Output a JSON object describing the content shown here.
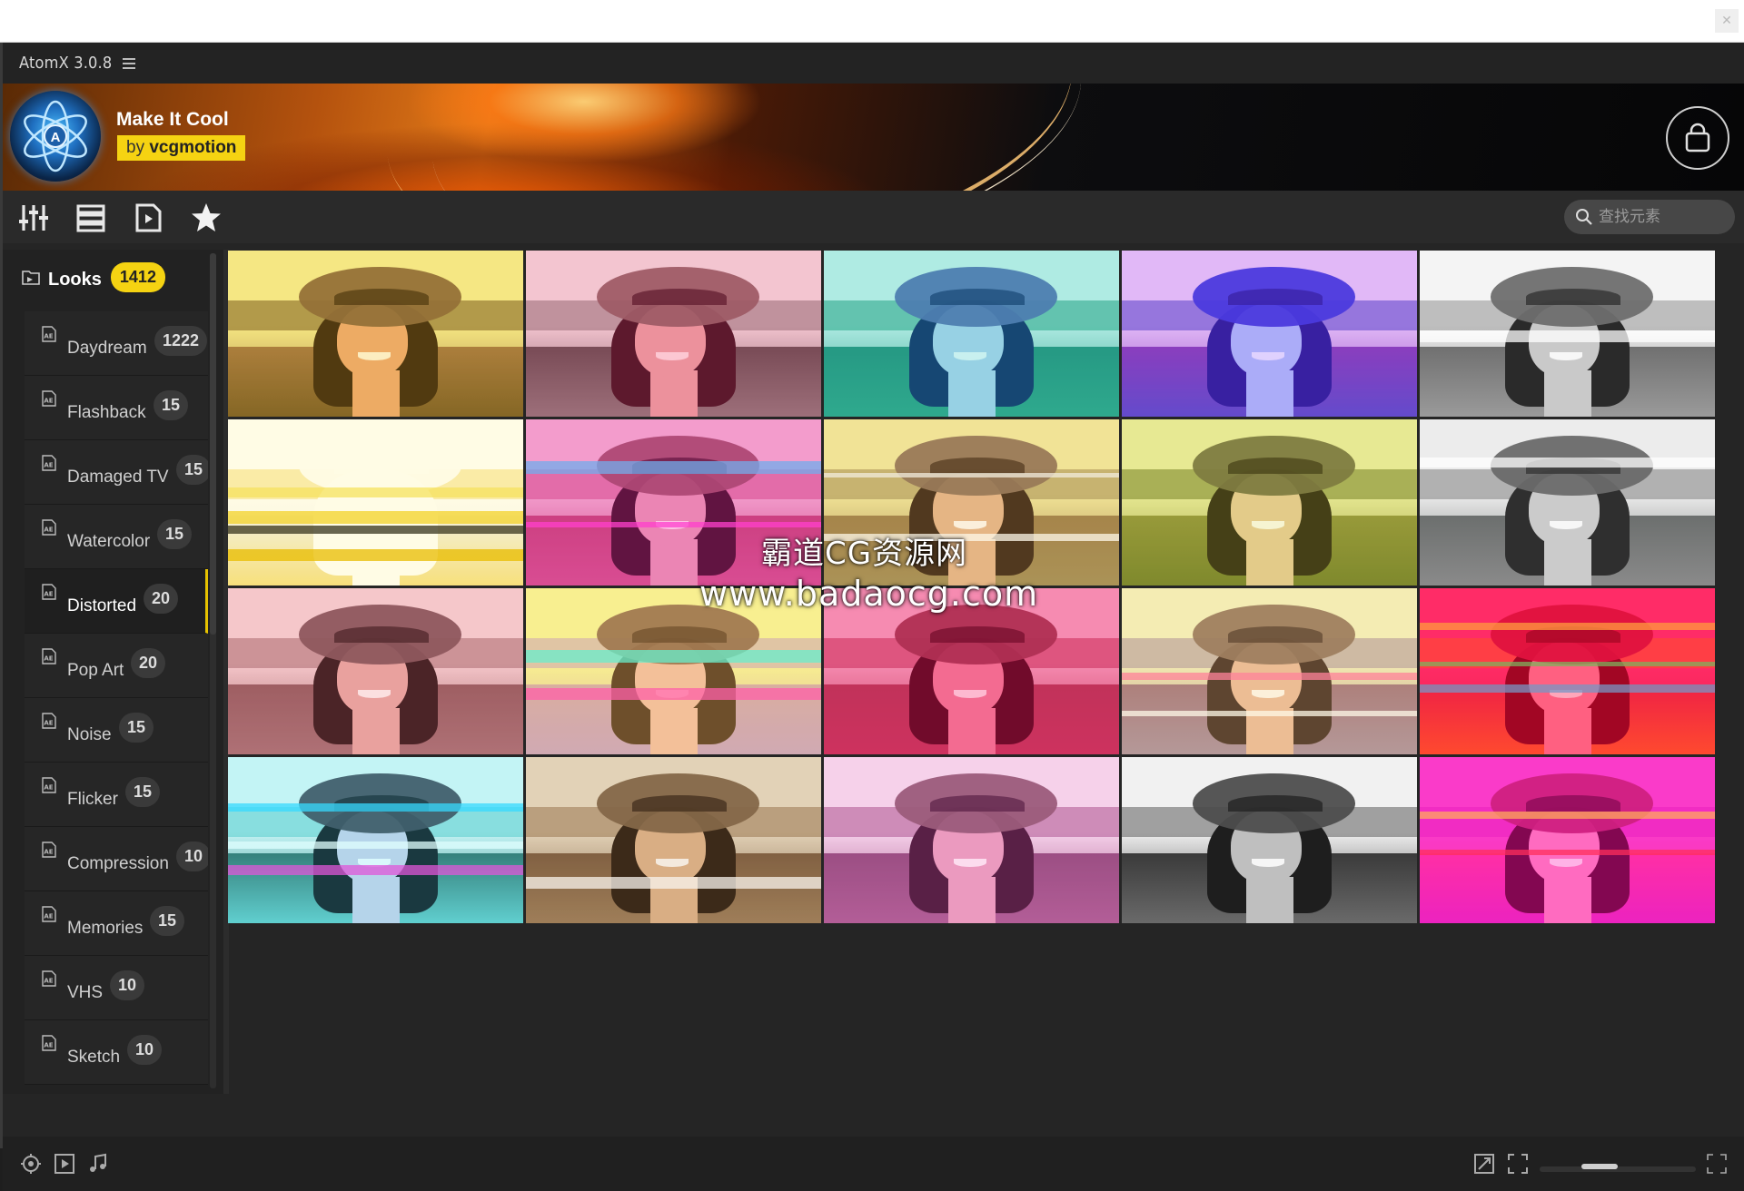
{
  "app": {
    "title": "AtomX 3.0.8"
  },
  "pack": {
    "title": "Make It Cool",
    "author_prefix": "by",
    "author": "vcgmotion"
  },
  "icons": {
    "menu": "hamburger-icon",
    "shop": "shopping-bag-icon",
    "tools": [
      "sliders-icon",
      "list-icon",
      "media-file-icon",
      "star-icon"
    ],
    "search": "search-icon",
    "category": "after-effects-file-icon",
    "bottom_left": [
      "target-icon",
      "play-icon",
      "music-note-icon"
    ],
    "bottom_right": [
      "resize-icon",
      "fullscreen-icon",
      "expand-icon"
    ]
  },
  "search": {
    "placeholder": "查找元素"
  },
  "sidebar": {
    "root": {
      "label": "Looks",
      "count": "1412"
    },
    "items": [
      {
        "label": "Daydream",
        "count": "1222"
      },
      {
        "label": "Flashback",
        "count": "15"
      },
      {
        "label": "Damaged TV",
        "count": "15"
      },
      {
        "label": "Watercolor",
        "count": "15"
      },
      {
        "label": "Distorted",
        "count": "20",
        "active": true
      },
      {
        "label": "Pop Art",
        "count": "20"
      },
      {
        "label": "Noise",
        "count": "15"
      },
      {
        "label": "Flicker",
        "count": "15"
      },
      {
        "label": "Compression",
        "count": "10"
      },
      {
        "label": "Memories",
        "count": "15"
      },
      {
        "label": "VHS",
        "count": "10"
      },
      {
        "label": "Sketch",
        "count": "10"
      }
    ]
  },
  "watermark": {
    "line1": "霸道CG资源网",
    "line2": "www.badaocg.com"
  },
  "zoom_slider": {
    "value_fraction": 0.35
  },
  "colors": {
    "accent": "#f5d312",
    "background": "#1e1e1e",
    "panel": "#262626"
  },
  "thumbnails": [
    {
      "sky": "#f3e9a0",
      "field": "#9a6a4a",
      "trees": "#6b4d2d",
      "hat": "#7d5a44",
      "hair": "#2b1714",
      "face": "#e9a07a",
      "tint": "rgba(255,220,0,0.18)",
      "glitch": []
    },
    {
      "sky": "#f1f1f1",
      "field": "#5c5c5c",
      "trees": "#888",
      "hat": "#8a7070",
      "hair": "#3a1f2a",
      "face": "#e8b1b1",
      "tint": "rgba(255,0,60,0.18)",
      "glitch": []
    },
    {
      "sky": "#d6f3ee",
      "field": "#2e8f7a",
      "trees": "#3aa386",
      "hat": "#5f6fb0",
      "hair": "#1c2b66",
      "face": "#b9d4f0",
      "tint": "rgba(0,200,180,0.18)",
      "glitch": []
    },
    {
      "sky": "#f7d8f5",
      "field": "#8a3fae",
      "trees": "#5a4fbf",
      "hat": "#3b3ad6",
      "hair": "#241a8a",
      "face": "#b3c8f7",
      "tint": "rgba(140,60,255,0.2)",
      "glitch": []
    },
    {
      "sky": "#f4f4f4",
      "field": "#707070",
      "trees": "#9a9a9a",
      "hat": "#6e6e6e",
      "hair": "#2a2a2a",
      "face": "#c9c9c9",
      "tint": "rgba(0,0,0,0)",
      "glitch": [
        "#ffffff"
      ]
    },
    {
      "sky": "#ffffff",
      "field": "#f2f2f2",
      "trees": "#f6e08a",
      "hat": "#ffffff",
      "hair": "#ffffff",
      "face": "#ffffff",
      "tint": "rgba(255,230,0,0.1)",
      "glitch": [
        "#f1d12f",
        "#e6b800",
        "#f5e36a",
        "#222222"
      ]
    },
    {
      "sky": "#f0c4d8",
      "field": "#c0507a",
      "trees": "#d06090",
      "hat": "#9a5a6a",
      "hair": "#3a1a2a",
      "face": "#e6a7b9",
      "tint": "rgba(255,0,160,0.2)",
      "glitch": [
        "#ff4fd8",
        "#4fd8ff"
      ]
    },
    {
      "sky": "#efe5a0",
      "field": "#9a7a4a",
      "trees": "#a08a58",
      "hat": "#8b6e5a",
      "hair": "#3a2418",
      "face": "#e2b18b",
      "tint": "rgba(255,210,80,0.12)",
      "glitch": [
        "#ffffff",
        "#f0f0f0"
      ]
    },
    {
      "sky": "#e9eaa6",
      "field": "#8c8d3d",
      "trees": "#6f7a2e",
      "hat": "#6f6a44",
      "hair": "#2b2414",
      "face": "#e4c79a",
      "tint": "rgba(220,230,40,0.15)",
      "glitch": []
    },
    {
      "sky": "#ececec",
      "field": "#6c6f6e",
      "trees": "#8a8a8a",
      "hat": "#6a6a6a",
      "hair": "#2f2f2f",
      "face": "#cbcbcb",
      "tint": "rgba(0,0,0,0)",
      "glitch": [
        "#ffffff"
      ]
    },
    {
      "sky": "#f4d5d8",
      "field": "#8e5a5e",
      "trees": "#a17074",
      "hat": "#7b5257",
      "hair": "#2c1618",
      "face": "#e5a9a4",
      "tint": "rgba(255,120,130,0.15)",
      "glitch": []
    },
    {
      "sky": "#f7f2b5",
      "field": "#d0a0c8",
      "trees": "#c59ae0",
      "hat": "#8a5f66",
      "hair": "#4a2a36",
      "face": "#f0b7c0",
      "tint": "rgba(255,230,0,0.2)",
      "glitch": [
        "#43f0ff",
        "#ff3fd1"
      ]
    },
    {
      "sky": "#f4b3c9",
      "field": "#b0405a",
      "trees": "#c04060",
      "hat": "#9a3d52",
      "hair": "#4a0f1e",
      "face": "#f08aa0",
      "tint": "rgba(255,0,90,0.22)",
      "glitch": []
    },
    {
      "sky": "#f2f0c0",
      "field": "#9c6c7c",
      "trees": "#a58aa0",
      "hat": "#8a6a5a",
      "hair": "#3b2420",
      "face": "#e8b69a",
      "tint": "rgba(255,220,120,0.18)",
      "glitch": [
        "#ff6fa0",
        "#ffffff"
      ]
    },
    {
      "sky": "#ff3f7a",
      "field": "#e8304a",
      "trees": "#ff6a2a",
      "hat": "#d41a40",
      "hair": "#7a0a1a",
      "face": "#ff8aa0",
      "tint": "rgba(255,0,60,0.3)",
      "glitch": [
        "#3fd7ff",
        "#ffe03f",
        "#46ff6b"
      ]
    },
    {
      "sky": "#dff3f4",
      "field": "#3e6f6a",
      "trees": "#6ec9c9",
      "hat": "#4a4a58",
      "hair": "#1e1e26",
      "face": "#cfcfe8",
      "tint": "rgba(0,255,255,0.12)",
      "glitch": [
        "#ff3fd4",
        "#3fd4ff",
        "#ffffff"
      ]
    },
    {
      "sky": "#e6d8c2",
      "field": "#7a5a40",
      "trees": "#9b7b59",
      "hat": "#7d6247",
      "hair": "#2d1d12",
      "face": "#dcb08a",
      "tint": "rgba(200,160,90,0.1)",
      "glitch": [
        "#ffffff"
      ]
    },
    {
      "sky": "#f5e4f0",
      "field": "#8b4b78",
      "trees": "#a65d8f",
      "hat": "#8a5a6e",
      "hair": "#3d1530",
      "face": "#e8a4be",
      "tint": "rgba(255,100,200,0.15)",
      "glitch": []
    },
    {
      "sky": "#f1f1f1",
      "field": "#3a3a3a",
      "trees": "#6a6a6a",
      "hat": "#4d4d4d",
      "hair": "#1e1e1e",
      "face": "#bfbfbf",
      "tint": "rgba(0,0,0,0)",
      "glitch": []
    },
    {
      "sky": "#f84fd0",
      "field": "#ff3fa0",
      "trees": "#e62fc4",
      "hat": "#c02a70",
      "hair": "#5a0a30",
      "face": "#ff8fc5",
      "tint": "rgba(255,0,180,0.25)",
      "glitch": [
        "#ffe43f",
        "#ff3f3f"
      ]
    }
  ]
}
